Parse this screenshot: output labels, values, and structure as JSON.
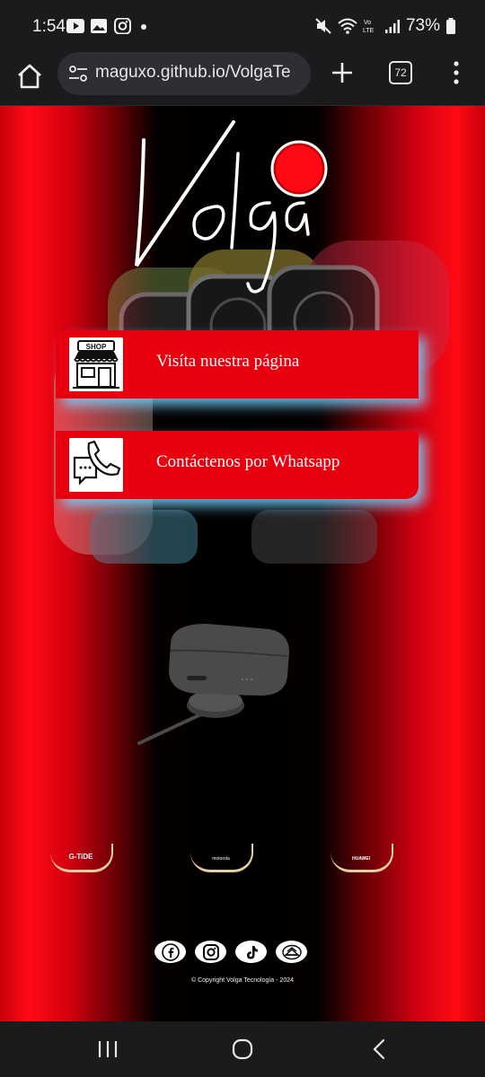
{
  "status_bar": {
    "time": "1:54",
    "battery": "73%",
    "left_icons": [
      "youtube-icon",
      "gallery-icon",
      "instagram-icon",
      "dot-icon"
    ],
    "right_icons": [
      "mute-icon",
      "wifi-icon",
      "volte-icon",
      "signal-icon",
      "battery-icon"
    ]
  },
  "browser": {
    "url": "maguxo.github.io/VolgaTe",
    "tab_count": "72"
  },
  "page": {
    "logo_text": "Volga",
    "links": [
      {
        "label": "Visíta nuestra página",
        "icon": "shop-icon"
      },
      {
        "label": "Contáctenos por Whatsapp",
        "icon": "phone-icon"
      }
    ],
    "brands": [
      "G-TiDE",
      "motorola",
      "HUAWEI"
    ],
    "social": [
      "facebook-icon",
      "instagram-icon",
      "tiktok-icon",
      "email-icon"
    ],
    "copyright": "© Copyright Volga Tecnología - 2024"
  },
  "colors": {
    "accent_red": "#e8000e",
    "glow": "#78d2ff"
  }
}
